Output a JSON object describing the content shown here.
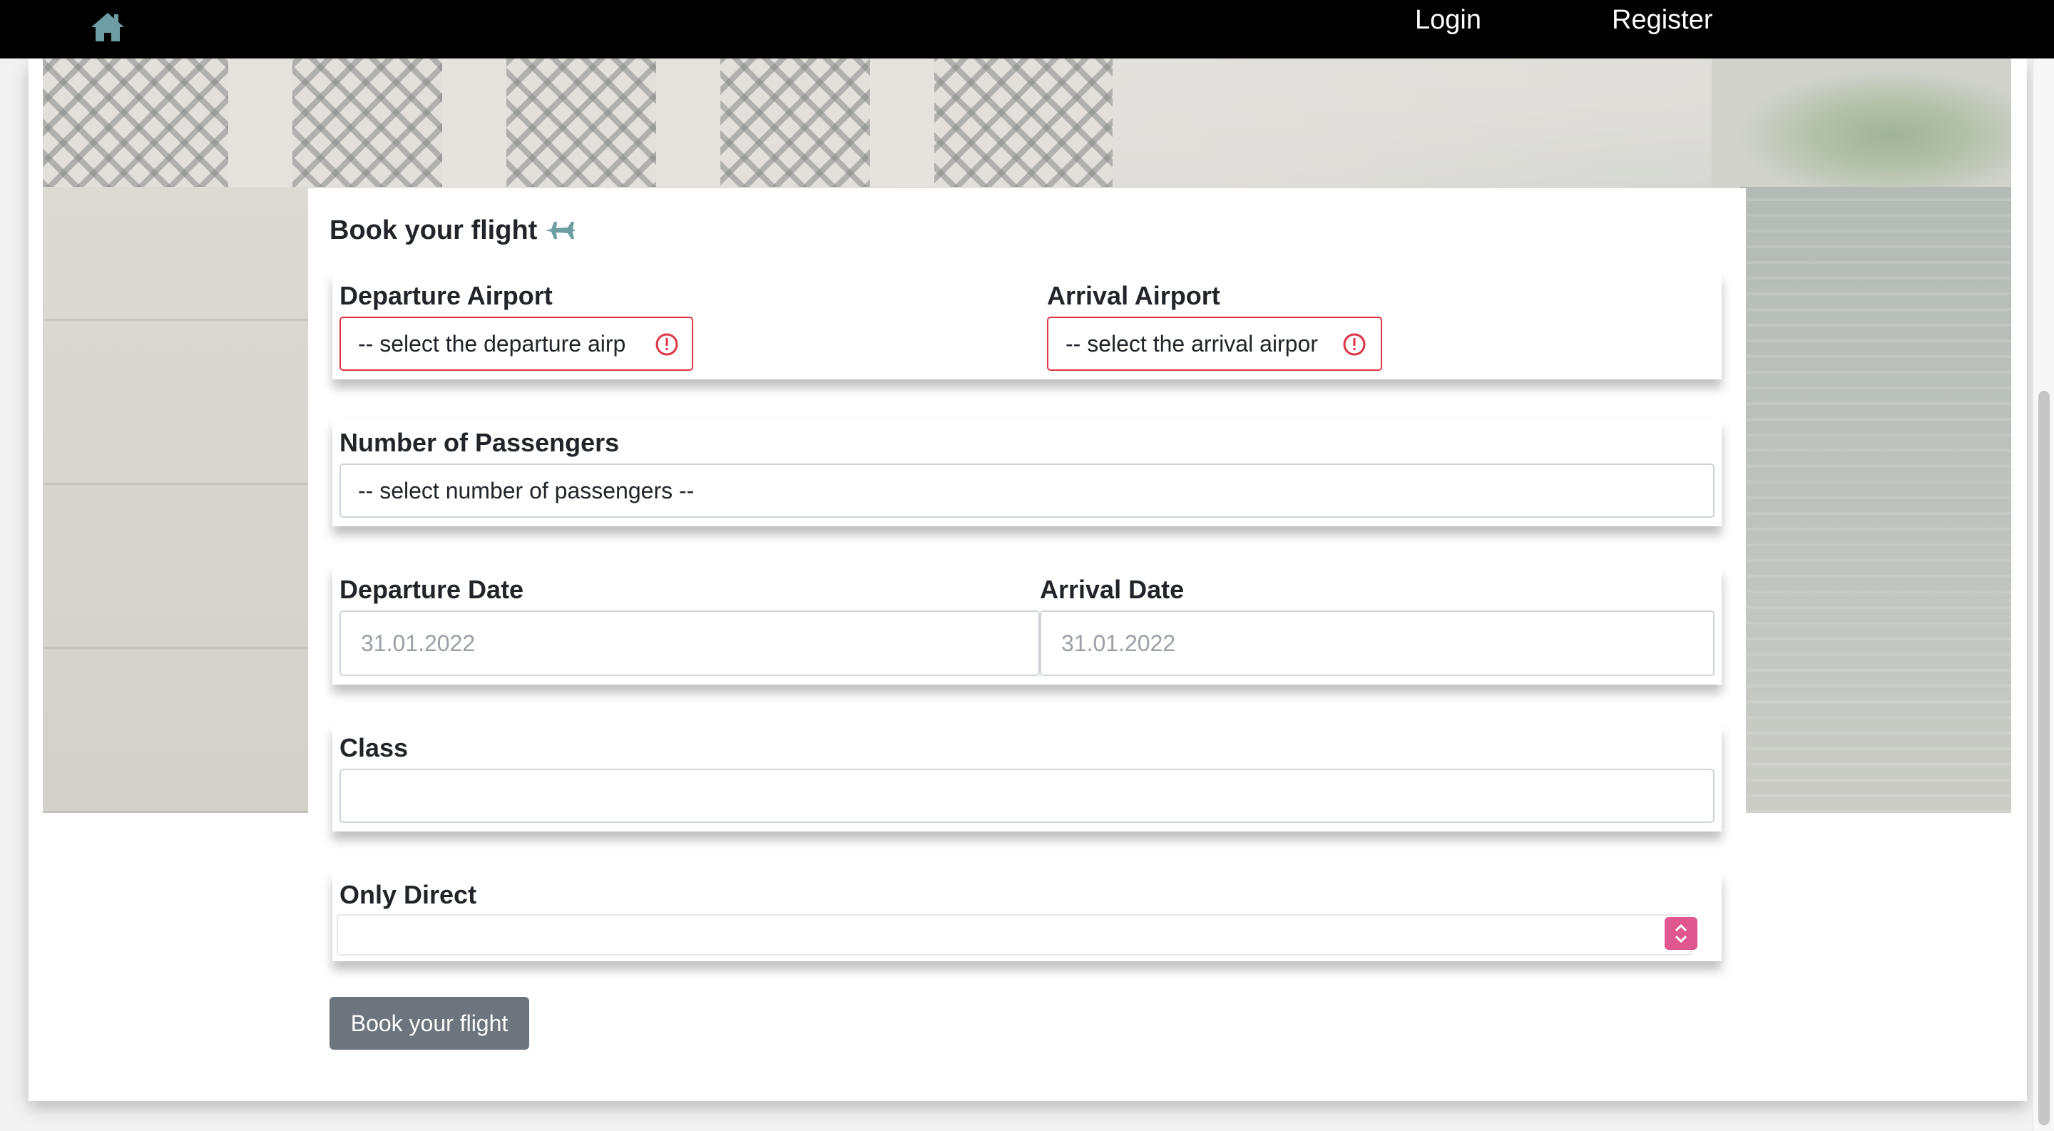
{
  "nav": {
    "home_icon": "home-icon",
    "login": "Login",
    "register": "Register"
  },
  "form": {
    "title": "Book your flight",
    "title_icon": "airplane-icon",
    "departure_airport": {
      "label": "Departure Airport",
      "value": "-- select the departure airp",
      "status_icon": "exclamation-circle-icon"
    },
    "arrival_airport": {
      "label": "Arrival Airport",
      "value": "-- select the arrival airpor",
      "status_icon": "exclamation-circle-icon"
    },
    "passengers": {
      "label": "Number of Passengers",
      "value": "-- select number of passengers --"
    },
    "departure_date": {
      "label": "Departure Date",
      "value": "31.01.2022"
    },
    "arrival_date": {
      "label": "Arrival Date",
      "value": "31.01.2022"
    },
    "class": {
      "label": "Class",
      "value": ""
    },
    "only_direct": {
      "label": "Only Direct",
      "value": ""
    },
    "submit": "Book your flight"
  },
  "colors": {
    "nav_bg": "#000000",
    "icon_teal": "#6e9ea3",
    "invalid_red": "#dc3545",
    "button_gray": "#6c757d",
    "stepper_pink": "#e0578f"
  }
}
